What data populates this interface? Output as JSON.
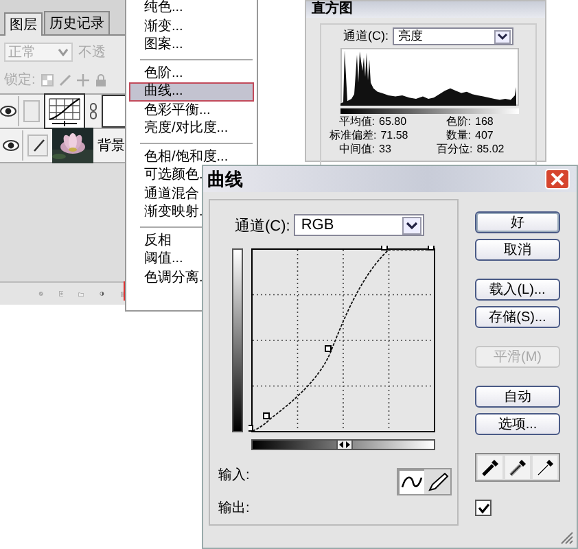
{
  "layers_panel": {
    "tabs": [
      {
        "label": "图层",
        "selected": true
      },
      {
        "label": "历史记录",
        "selected": false
      }
    ],
    "blend_mode": "正常",
    "opacity_label": "不透",
    "lock_label": "锁定:",
    "layers": [
      {
        "kind": "adjustment",
        "visible": true
      },
      {
        "visible": true,
        "name": "背景"
      }
    ]
  },
  "adjustment_menu": {
    "groups": [
      [
        {
          "label": "纯色...",
          "selected": false
        },
        {
          "label": "渐变...",
          "selected": false
        },
        {
          "label": "图案...",
          "selected": false
        }
      ],
      [
        {
          "label": "色阶...",
          "selected": false
        },
        {
          "label": "曲线...",
          "selected": true
        },
        {
          "label": "色彩平衡...",
          "selected": false
        },
        {
          "label": "亮度/对比度...",
          "selected": false
        }
      ],
      [
        {
          "label": "色相/饱和度...",
          "selected": false
        },
        {
          "label": "可选颜色.",
          "selected": false
        },
        {
          "label": "通道混合",
          "selected": false
        },
        {
          "label": "渐变映射.",
          "selected": false
        }
      ],
      [
        {
          "label": "反相",
          "selected": false
        },
        {
          "label": "阈值...",
          "selected": false
        },
        {
          "label": "色调分离.",
          "selected": false
        }
      ]
    ]
  },
  "histogram": {
    "title": "直方图",
    "channel_label": "通道(C):",
    "channel": "亮度",
    "stats": [
      {
        "label": "平均值:",
        "value": "65.80"
      },
      {
        "label": "色阶:",
        "value": "168"
      },
      {
        "label": "标准偏差:",
        "value": "71.58"
      },
      {
        "label": "数量:",
        "value": "407"
      },
      {
        "label": "中间值:",
        "value": "33"
      },
      {
        "label": "百分位:",
        "value": "85.02"
      }
    ]
  },
  "curves_dialog": {
    "title": "曲线",
    "channel_label": "通道(C):",
    "channel": "RGB",
    "input_label": "输入:",
    "output_label": "输出:",
    "tools": [
      {
        "kind": "curve",
        "selected": true
      },
      {
        "kind": "pencil",
        "selected": false
      }
    ],
    "button_groups": [
      [
        {
          "label": "好",
          "default": true,
          "disabled": false
        },
        {
          "label": "取消",
          "default": false,
          "disabled": false
        }
      ],
      [
        {
          "label": "载入(L)...",
          "default": false,
          "disabled": false
        },
        {
          "label": "存储(S)...",
          "default": false,
          "disabled": false
        }
      ],
      [
        {
          "label": "平滑(M)",
          "default": false,
          "disabled": true
        }
      ],
      [
        {
          "label": "自动",
          "default": false,
          "disabled": false
        },
        {
          "label": "选项...",
          "default": false,
          "disabled": false
        }
      ]
    ],
    "preview": {
      "checked": true
    }
  }
}
